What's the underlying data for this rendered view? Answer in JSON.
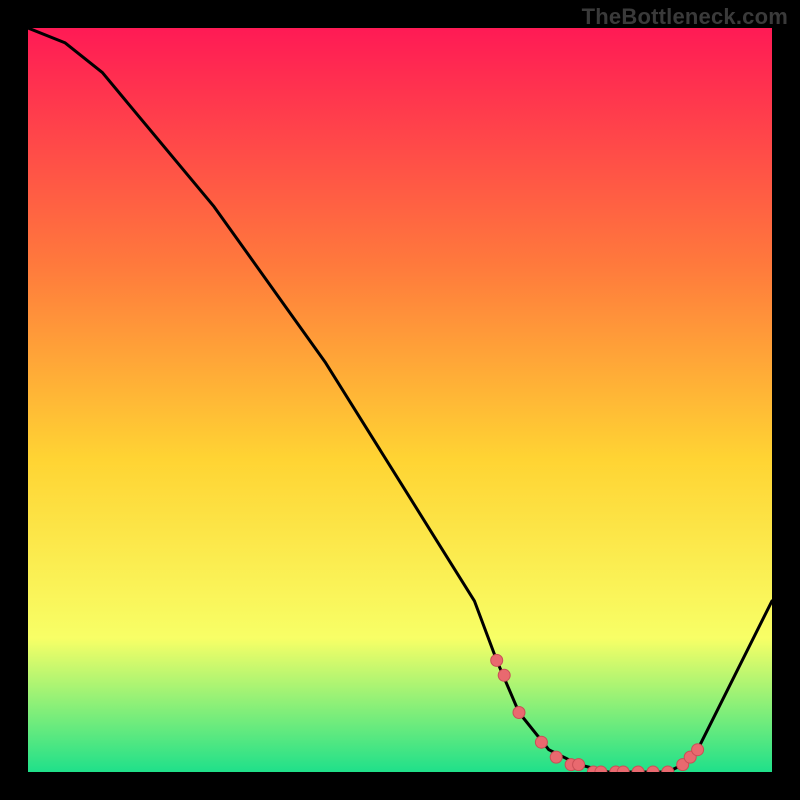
{
  "watermark": "TheBottleneck.com",
  "colors": {
    "gradient_top": "#ff1a55",
    "gradient_mid1": "#ff7a3c",
    "gradient_mid2": "#ffd433",
    "gradient_mid3": "#f8ff66",
    "gradient_bottom": "#1fe08a",
    "curve": "#000000",
    "marker_fill": "#e9696f",
    "marker_stroke": "#c94f56"
  },
  "chart_data": {
    "type": "line",
    "title": "",
    "xlabel": "",
    "ylabel": "",
    "xlim": [
      0,
      100
    ],
    "ylim": [
      0,
      100
    ],
    "series": [
      {
        "name": "bottleneck-curve",
        "x": [
          0,
          5,
          10,
          15,
          20,
          25,
          30,
          35,
          40,
          45,
          50,
          55,
          60,
          63,
          66,
          70,
          74,
          78,
          82,
          86,
          88,
          90,
          92,
          95,
          100
        ],
        "values": [
          100,
          98,
          94,
          88,
          82,
          76,
          69,
          62,
          55,
          47,
          39,
          31,
          23,
          15,
          8,
          3,
          1,
          0,
          0,
          0,
          1,
          3,
          7,
          13,
          23
        ]
      }
    ],
    "markers": {
      "name": "highlighted-points",
      "x": [
        63,
        64,
        66,
        69,
        71,
        73,
        74,
        76,
        77,
        79,
        80,
        82,
        84,
        86,
        88,
        89,
        90
      ],
      "values": [
        15,
        13,
        8,
        4,
        2,
        1,
        1,
        0,
        0,
        0,
        0,
        0,
        0,
        0,
        1,
        2,
        3
      ]
    }
  }
}
